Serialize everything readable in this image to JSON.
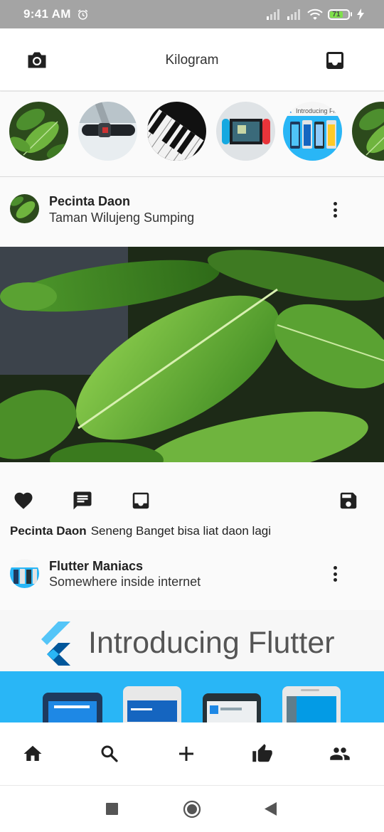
{
  "status_bar": {
    "time": "9:41 AM",
    "battery_level": "71",
    "icons": [
      "alarm-icon",
      "signal-icon",
      "signal-icon",
      "wifi-icon",
      "battery-icon",
      "charging-icon"
    ]
  },
  "app_bar": {
    "title": "Kilogram",
    "left_icon": "camera-icon",
    "right_icon": "inbox-icon"
  },
  "stories": [
    {
      "name": "story-leaves"
    },
    {
      "name": "story-scooter-handle"
    },
    {
      "name": "story-piano-keys"
    },
    {
      "name": "story-nintendo-switch"
    },
    {
      "name": "story-introducing-flutter",
      "text": "Introducing Flutter"
    },
    {
      "name": "story-leaves"
    }
  ],
  "posts": [
    {
      "user": "Pecinta Daon",
      "location": "Taman Wilujeng Sumping",
      "image": "green-leaves-photo",
      "actions": [
        "heart-icon",
        "comment-icon",
        "inbox-icon",
        "save-icon"
      ],
      "caption_user": "Pecinta Daon",
      "caption_text": "Seneng Banget bisa liat daon lagi"
    },
    {
      "user": "Flutter Maniacs",
      "location": "Somewhere inside internet",
      "image_text": "Introducing Flutter"
    }
  ],
  "bottom_nav": [
    "home-icon",
    "search-icon",
    "add-icon",
    "thumb-up-icon",
    "people-icon"
  ],
  "system_nav": [
    "recents-icon",
    "home-circle-icon",
    "back-icon"
  ],
  "colors": {
    "status_bar": "#a4a4a4",
    "battery": "#7fe04b",
    "leaf_green": "#4d9a2a",
    "flutter_blue": "#29b6f6"
  }
}
